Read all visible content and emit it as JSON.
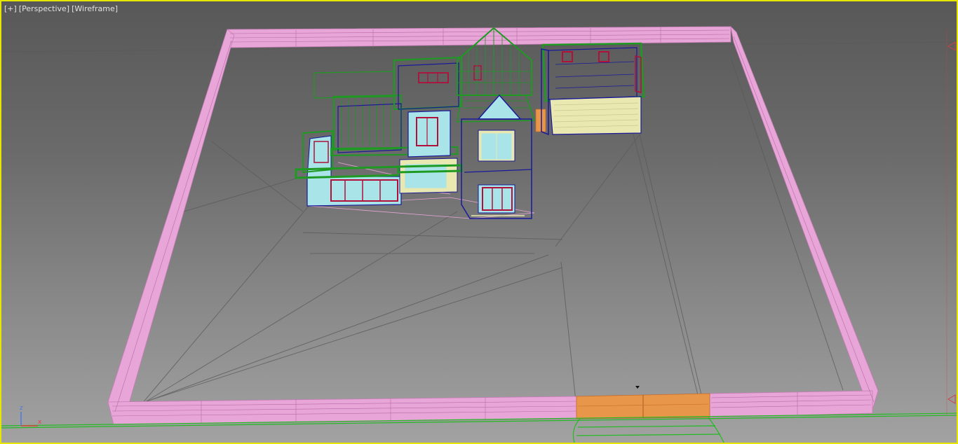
{
  "viewport": {
    "labels": [
      "[+]",
      "[Perspective]",
      "[Wireframe]"
    ]
  },
  "axis_gizmo": {
    "z_label": "z",
    "x_label": "x"
  },
  "colors": {
    "fence": "#e8a6d8",
    "gate": "#e8964a",
    "roof": "#1e9a22",
    "frame": "#1a1a9a",
    "window_frame": "#b0103a",
    "glass": "#a8e4e8",
    "stairs": "#e8e8b0",
    "ground_lines": "#5a5a5a",
    "ground_green": "#22bb22",
    "viewport_border": "#e6e600",
    "axis_z": "#4a7ae0",
    "axis_x": "#e04040"
  },
  "icons": {
    "cursor": "cursor-icon",
    "axis": "axis-gizmo-icon",
    "camera": "camera-marker-icon"
  }
}
